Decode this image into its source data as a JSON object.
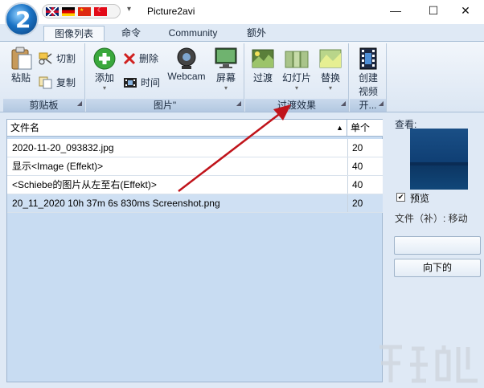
{
  "window": {
    "title": "Picture2avi",
    "logo_text": "2",
    "minimize_icon": "—",
    "maximize_icon": "☐",
    "close_icon": "✕",
    "quick_access_icon": "▾"
  },
  "languages": [
    "english-flag",
    "german-flag",
    "chinese-flag",
    "turkish-flag"
  ],
  "tabs": [
    {
      "label": "图像列表",
      "active": true
    },
    {
      "label": "命令"
    },
    {
      "label": "Community"
    },
    {
      "label": "额外"
    }
  ],
  "ribbon": {
    "clipboard": {
      "paste": "粘贴",
      "cut": "切割",
      "copy": "复制",
      "group": "剪贴板"
    },
    "pictures": {
      "add": "添加",
      "delete": "删除",
      "time": "时间",
      "webcam": "Webcam",
      "screen": "屏幕",
      "group": "图片\""
    },
    "effects": {
      "transition": "过渡",
      "slideshow": "幻灯片",
      "replace": "替换",
      "group": "过渡效果"
    },
    "create": {
      "label_line1": "创建",
      "label_line2": "视频",
      "group": "开..."
    }
  },
  "list": {
    "col_name": "文件名",
    "col_unit": "单个",
    "sort_icon": "▲",
    "rows": [
      {
        "name": "2020-11-20_093832.jpg",
        "unit": "20"
      },
      {
        "name": "显示<Image (Effekt)>",
        "unit": "40"
      },
      {
        "name": "<Schiebe的图片从左至右(Effekt)>",
        "unit": "40"
      },
      {
        "name": "20_11_2020 10h 37m 6s 830ms Screenshot.png",
        "unit": "20",
        "selected": true
      }
    ]
  },
  "sidepanel": {
    "view_label": "查看:",
    "preview_checked": "✔",
    "preview_label": "预览",
    "file_label": "文件（补）: 移动",
    "up_button": "",
    "down_button": "向下的"
  },
  "colors": {
    "ribbon_bg": "#e6eef8",
    "list_bg": "#c8dcf2",
    "selected_row": "#cfe0f3",
    "arrow": "#c0141b"
  }
}
